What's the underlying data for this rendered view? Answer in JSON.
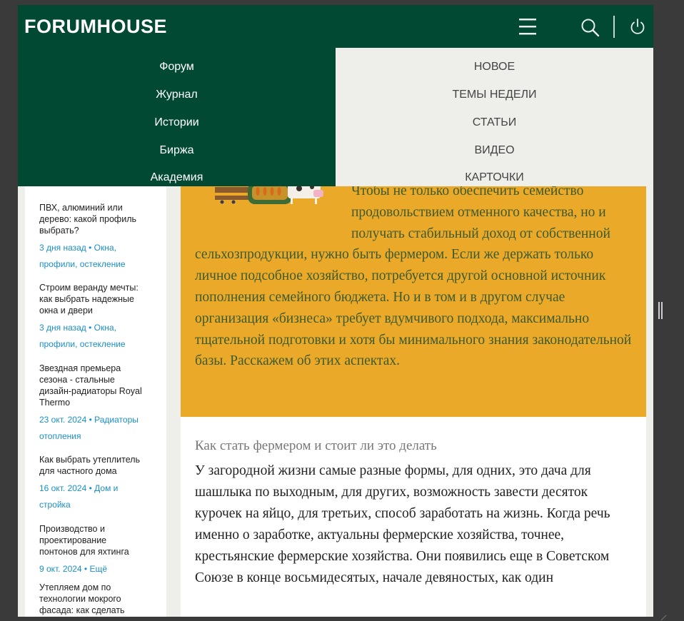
{
  "header": {
    "logo": "FORUMHOUSE"
  },
  "nav_left": [
    "Форум",
    "Журнал",
    "Истории",
    "Биржа",
    "Академия"
  ],
  "nav_right": [
    "НОВОЕ",
    "ТЕМЫ НЕДЕЛИ",
    "СТАТЬИ",
    "ВИДЕО",
    "КАРТОЧКИ"
  ],
  "sidebar": {
    "items": [
      {
        "title": "ПВХ, алюминий или дерево: какой профиль выбрать?",
        "meta": "3 дня назад • Окна, профили, остекление"
      },
      {
        "title": "Строим веранду мечты: как выбрать надежные окна и двери",
        "meta": "3 дня назад • Окна, профили, остекление"
      },
      {
        "title": "Звездная премьера сезона - стальные дизайн-радиаторы Royal Thermo",
        "meta": "23 окт. 2024 • Радиаторы отопления"
      },
      {
        "title": "Как выбрать утеплитель для частного дома",
        "meta": "16 окт. 2024 • Дом и стройка"
      },
      {
        "title": "Производство и проектирование понтонов для яхтинга",
        "meta": "9 окт. 2024 • Ещё"
      },
      {
        "title": "Утепляем дом по технологии мокрого фасада: как сделать",
        "meta": ""
      }
    ]
  },
  "article": {
    "intro": "Чтобы не только обеспечить семейство продовольствием отменного качества, но и получать стабильный доход от собственной сельхозпродукции, нужно быть фермером. Если же держать только личное подсобное хозяйство, потребуется другой основной источник пополнения семейного бюджета. Но и в том и в другом случае организация «бизнеса» требует вдумчивого подхода, максимально тщательной подготовки и хотя бы минимального знания законодательной базы. Расскажем об этих аспектах.",
    "section_heading": "Как стать фермером и стоит ли это делать",
    "body": "У загородной жизни самые разные формы, для одних, это дача для шашлыка по выходным, для других, возможность завести десяток курочек на яйцо, для третьих, способ заработать на жизнь. Когда речь именно о заработке, актуальны фермерские хозяйства, точнее, крестьянские фермерские хозяйства. Они появились еще в Советском Союзе в конце восьмидесятых, начале девяностых, как один"
  },
  "colors": {
    "brand_green": "#024934",
    "intro_bg": "#eba92a",
    "intro_text": "#3d5a2e",
    "link_blue": "#1a8fc7"
  },
  "icons": [
    "menu-icon",
    "search-icon",
    "power-icon",
    "farm-illustration",
    "resize-handle-icon"
  ]
}
